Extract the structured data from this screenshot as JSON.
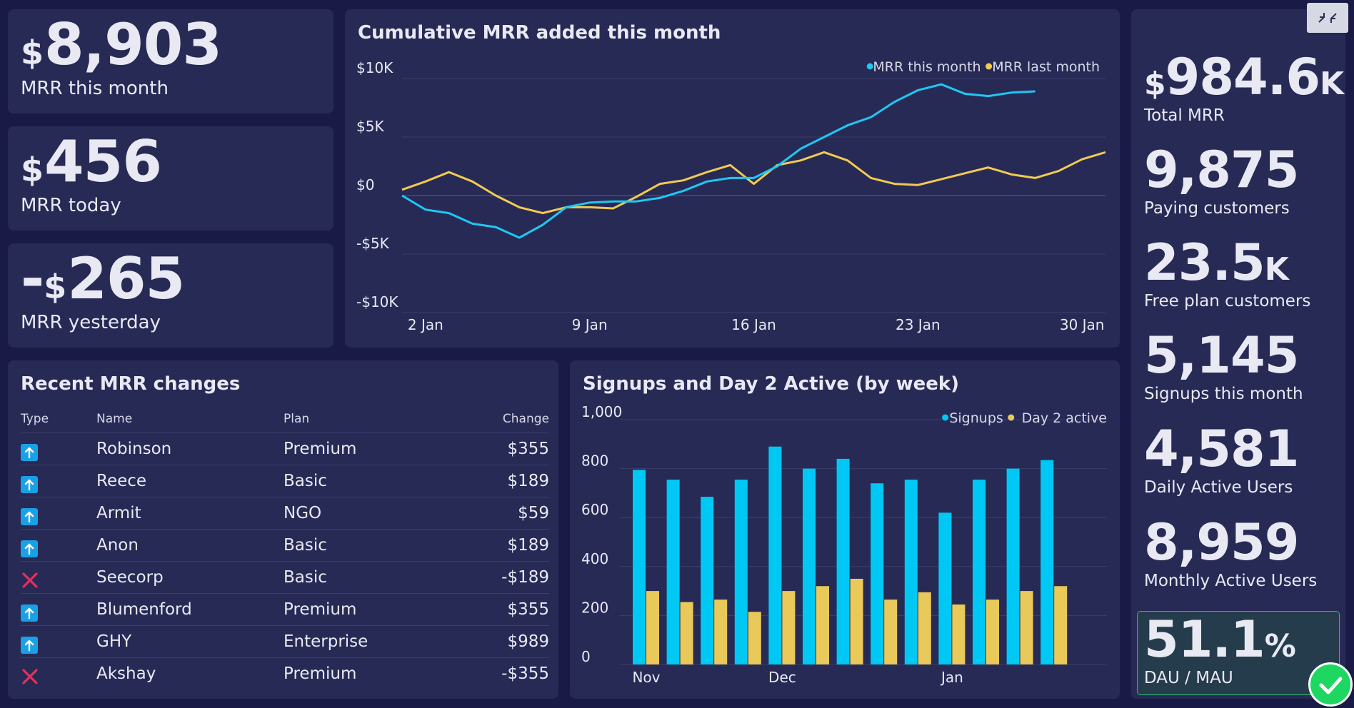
{
  "kpis_left": [
    {
      "prefix": "",
      "currency": "$",
      "value": "8,903",
      "label": "MRR this month"
    },
    {
      "prefix": "",
      "currency": "$",
      "value": "456",
      "label": "MRR today"
    },
    {
      "prefix": "-",
      "currency": "$",
      "value": "265",
      "label": "MRR yesterday"
    }
  ],
  "line_chart": {
    "title": "Cumulative MRR added this month",
    "chart_data": {
      "type": "line",
      "title": "Cumulative MRR added this month",
      "x_ticks": [
        "2 Jan",
        "9 Jan",
        "16 Jan",
        "23 Jan",
        "30 Jan"
      ],
      "y_ticks": [
        "$10K",
        "$5K",
        "$0",
        "-$5K",
        "-$10K"
      ],
      "ylim": [
        -10000,
        10000
      ],
      "xlim": [
        1,
        31
      ],
      "legend_position": "top-right",
      "series": [
        {
          "name": "MRR this month",
          "color": "#1ec8f2",
          "x": [
            1,
            2,
            3,
            4,
            5,
            6,
            7,
            8,
            9,
            10,
            11,
            12,
            13,
            14,
            15,
            16,
            17,
            18,
            19,
            20,
            21,
            22,
            23,
            24,
            25,
            26,
            27,
            28
          ],
          "y": [
            0,
            -1200,
            -1500,
            -2400,
            -2700,
            -3600,
            -2500,
            -1000,
            -600,
            -500,
            -500,
            -200,
            400,
            1200,
            1500,
            1500,
            2500,
            4000,
            5000,
            6000,
            6700,
            8000,
            9000,
            9500,
            8700,
            8500,
            8800,
            8903
          ]
        },
        {
          "name": "MRR last month",
          "color": "#f1ca52",
          "x": [
            1,
            2,
            3,
            4,
            5,
            6,
            7,
            8,
            9,
            10,
            11,
            12,
            13,
            14,
            15,
            16,
            17,
            18,
            19,
            20,
            21,
            22,
            23,
            24,
            25,
            26,
            27,
            28,
            29,
            30,
            31
          ],
          "y": [
            500,
            1200,
            2000,
            1200,
            0,
            -1000,
            -1500,
            -1000,
            -1000,
            -1100,
            -100,
            1000,
            1300,
            2000,
            2600,
            1000,
            2600,
            3000,
            3700,
            3000,
            1500,
            1000,
            900,
            1400,
            1900,
            2400,
            1800,
            1500,
            2100,
            3100,
            3700
          ]
        }
      ]
    }
  },
  "stats_right": [
    {
      "currency": "$",
      "value": "984.6",
      "suffix": "K",
      "label": "Total MRR"
    },
    {
      "currency": "",
      "value": "9,875",
      "suffix": "",
      "label": "Paying customers"
    },
    {
      "currency": "",
      "value": "23.5",
      "suffix": "K",
      "label": "Free plan customers"
    },
    {
      "currency": "",
      "value": "5,145",
      "suffix": "",
      "label": "Signups this month"
    },
    {
      "currency": "",
      "value": "4,581",
      "suffix": "",
      "label": "Daily Active Users"
    },
    {
      "currency": "",
      "value": "8,959",
      "suffix": "",
      "label": "Monthly Active Users"
    },
    {
      "currency": "",
      "value": "51.1",
      "suffix": "%",
      "label": "DAU / MAU"
    }
  ],
  "table": {
    "title": "Recent MRR changes",
    "headers": [
      "Type",
      "Name",
      "Plan",
      "Change"
    ],
    "rows": [
      {
        "type": "up",
        "name": "Robinson",
        "plan": "Premium",
        "change": "$355"
      },
      {
        "type": "up",
        "name": "Reece",
        "plan": "Basic",
        "change": "$189"
      },
      {
        "type": "up",
        "name": "Armit",
        "plan": "NGO",
        "change": "$59"
      },
      {
        "type": "up",
        "name": "Anon",
        "plan": "Basic",
        "change": "$189"
      },
      {
        "type": "down",
        "name": "Seecorp",
        "plan": "Basic",
        "change": "-$189"
      },
      {
        "type": "up",
        "name": "Blumenford",
        "plan": "Premium",
        "change": "$355"
      },
      {
        "type": "up",
        "name": "GHY",
        "plan": "Enterprise",
        "change": "$989"
      },
      {
        "type": "down",
        "name": "Akshay",
        "plan": "Premium",
        "change": "-$355"
      }
    ]
  },
  "bar_chart": {
    "title": "Signups and Day 2 Active (by week)",
    "chart_data": {
      "type": "bar",
      "title": "Signups and Day 2 Active (by week)",
      "ylim": [
        0,
        1000
      ],
      "y_ticks": [
        "0",
        "200",
        "400",
        "600",
        "800",
        "1,000"
      ],
      "x_ticks": [
        {
          "label": "Nov",
          "at": 0
        },
        {
          "label": "Dec",
          "at": 4
        },
        {
          "label": "Jan",
          "at": 9
        }
      ],
      "legend_position": "top-right",
      "categories_count": 13,
      "series": [
        {
          "name": "Signups",
          "color": "#00c8f4",
          "values": [
            795,
            755,
            685,
            755,
            890,
            800,
            840,
            740,
            755,
            620,
            755,
            800,
            835
          ]
        },
        {
          "name": "Day 2 active",
          "color": "#e9c95a",
          "values": [
            300,
            255,
            265,
            215,
            300,
            320,
            350,
            265,
            295,
            245,
            265,
            300,
            320
          ]
        }
      ]
    }
  },
  "icons": {
    "collapse": "collapse-icon",
    "ok": "check-circle-icon",
    "up": "arrow-up-icon",
    "down": "x-mark-icon"
  }
}
